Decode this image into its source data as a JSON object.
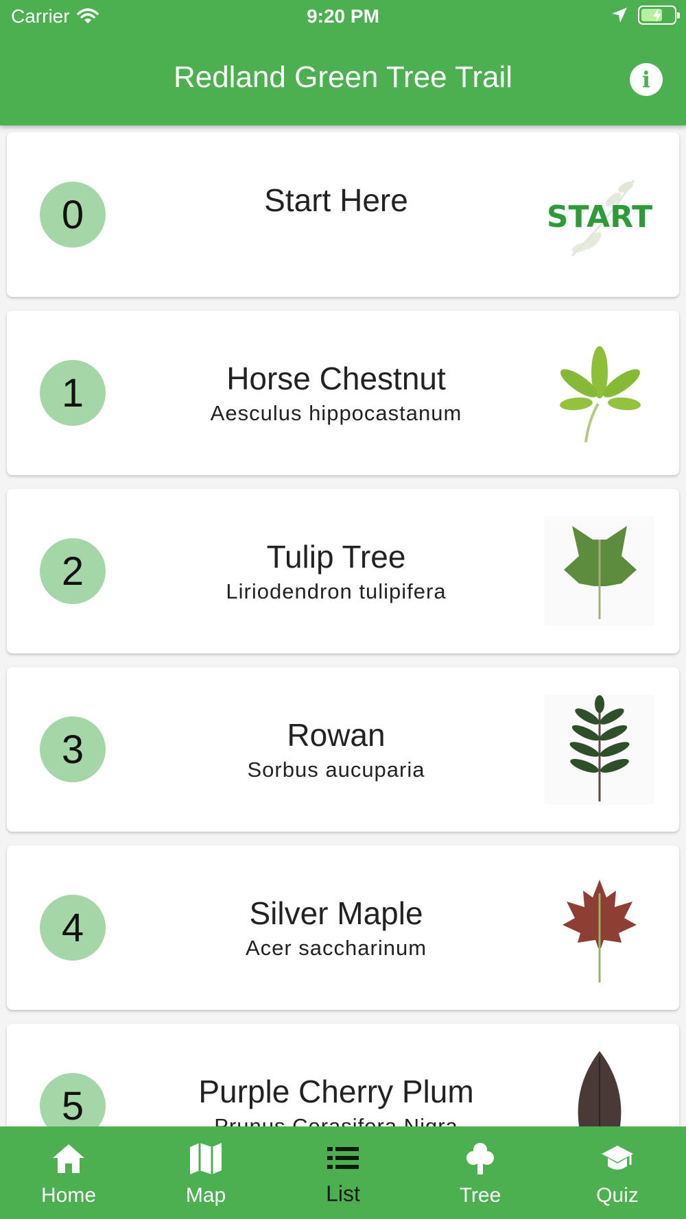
{
  "status_bar": {
    "carrier": "Carrier",
    "time": "9:20 PM"
  },
  "header": {
    "title": "Redland Green Tree Trail",
    "info_label": "i"
  },
  "colors": {
    "primary": "#4caf50",
    "badge": "#a5d6a7",
    "active_tab": "#0d1a0d"
  },
  "trees": [
    {
      "number": "0",
      "name": "Start Here",
      "latin": "",
      "thumb": "start-logo",
      "thumb_text": "START"
    },
    {
      "number": "1",
      "name": "Horse Chestnut",
      "latin": "Aesculus hippocastanum",
      "thumb": "horse-chestnut-leaf"
    },
    {
      "number": "2",
      "name": "Tulip Tree",
      "latin": "Liriodendron tulipifera",
      "thumb": "tulip-leaf"
    },
    {
      "number": "3",
      "name": "Rowan",
      "latin": "Sorbus aucuparia",
      "thumb": "rowan-leaf"
    },
    {
      "number": "4",
      "name": "Silver Maple",
      "latin": "Acer saccharinum",
      "thumb": "maple-leaf"
    },
    {
      "number": "5",
      "name": "Purple Cherry Plum",
      "latin": "Prunus Cerasifera Nigra",
      "thumb": "cherry-plum-leaf"
    }
  ],
  "tabs": [
    {
      "label": "Home",
      "icon": "home-icon"
    },
    {
      "label": "Map",
      "icon": "map-icon"
    },
    {
      "label": "List",
      "icon": "list-icon",
      "active": true
    },
    {
      "label": "Tree",
      "icon": "tree-icon"
    },
    {
      "label": "Quiz",
      "icon": "quiz-icon"
    }
  ]
}
